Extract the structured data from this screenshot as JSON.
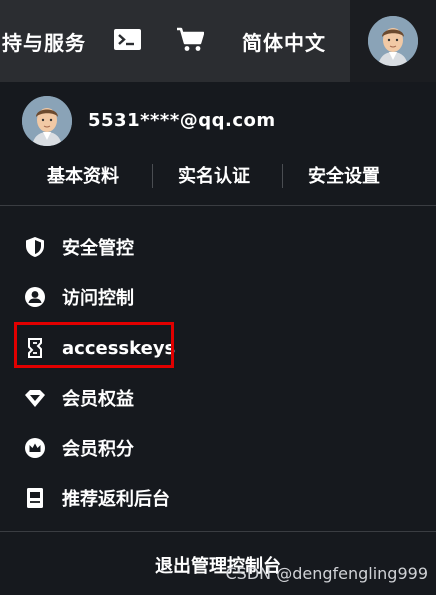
{
  "header": {
    "services_label": "持与服务",
    "language_label": "简体中文",
    "terminal_icon": "terminal-icon",
    "cart_icon": "cart-icon",
    "avatar_icon": "avatar-icon"
  },
  "profile": {
    "email": "5531****@qq.com",
    "links": [
      "基本资料",
      "实名认证",
      "安全设置"
    ]
  },
  "menu": {
    "items": [
      {
        "label": "安全管控",
        "icon": "shield-icon"
      },
      {
        "label": "访问控制",
        "icon": "user-circle-icon"
      },
      {
        "label": "accesskeys",
        "icon": "key-frame-icon",
        "highlighted": true
      },
      {
        "label": "会员权益",
        "icon": "diamond-icon"
      },
      {
        "label": "会员积分",
        "icon": "crown-icon"
      },
      {
        "label": "推荐返利后台",
        "icon": "document-icon"
      }
    ]
  },
  "logout_label": "退出管理控制台",
  "watermark": "CSDN @dengfengling999",
  "colors": {
    "background": "#16191e",
    "topbar": "#2b2d31",
    "highlight": "#e10000",
    "text": "#ffffff"
  }
}
